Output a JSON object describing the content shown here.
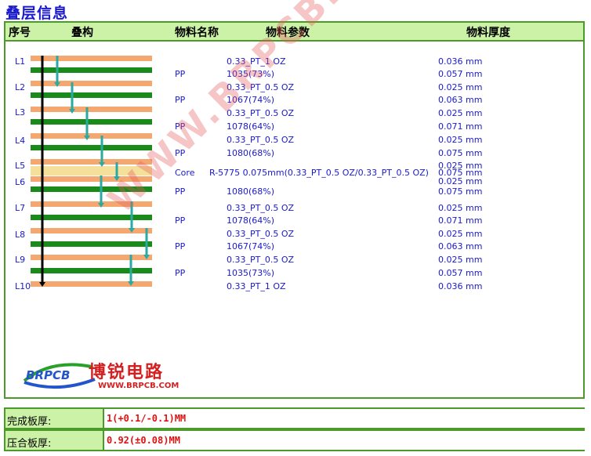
{
  "title": "叠层信息",
  "headers": {
    "seq": "序号",
    "struct": "叠构",
    "material_name": "物料名称",
    "material_param": "物料参数",
    "thickness": "物料厚度"
  },
  "layers": [
    "L1",
    "L2",
    "L3",
    "L4",
    "L5",
    "L6",
    "L7",
    "L8",
    "L9",
    "L10"
  ],
  "rows": [
    {
      "name": "",
      "param": "0.33_PT_1 OZ",
      "thick": "0.036 mm"
    },
    {
      "name": "PP",
      "param": "1035(73%)",
      "thick": "0.057 mm"
    },
    {
      "name": "",
      "param": "0.33_PT_0.5 OZ",
      "thick": "0.025 mm"
    },
    {
      "name": "PP",
      "param": "1067(74%)",
      "thick": "0.063 mm"
    },
    {
      "name": "",
      "param": "0.33_PT_0.5 OZ",
      "thick": "0.025 mm"
    },
    {
      "name": "PP",
      "param": "1078(64%)",
      "thick": "0.071 mm"
    },
    {
      "name": "",
      "param": "0.33_PT_0.5 OZ",
      "thick": "0.025 mm"
    },
    {
      "name": "PP",
      "param": "1080(68%)",
      "thick": "0.075 mm"
    },
    {
      "name": "",
      "param": "",
      "thick": "0.025 mm"
    },
    {
      "name": "Core",
      "param": "R-5775 0.075mm(0.33_PT_0.5 OZ/0.33_PT_0.5 OZ)",
      "thick": "0.075 mm"
    },
    {
      "name": "",
      "param": "",
      "thick": "0.025 mm"
    },
    {
      "name": "PP",
      "param": "1080(68%)",
      "thick": "0.075 mm"
    },
    {
      "name": "",
      "param": "0.33_PT_0.5 OZ",
      "thick": "0.025 mm"
    },
    {
      "name": "PP",
      "param": "1078(64%)",
      "thick": "0.071 mm"
    },
    {
      "name": "",
      "param": "0.33_PT_0.5 OZ",
      "thick": "0.025 mm"
    },
    {
      "name": "PP",
      "param": "1067(74%)",
      "thick": "0.063 mm"
    },
    {
      "name": "",
      "param": "0.33_PT_0.5 OZ",
      "thick": "0.025 mm"
    },
    {
      "name": "PP",
      "param": "1035(73%)",
      "thick": "0.057 mm"
    },
    {
      "name": "",
      "param": "0.33_PT_1 OZ",
      "thick": "0.036 mm"
    }
  ],
  "watermark": "WWW.BRPCB.COM",
  "logo": {
    "badge": "BRPCB",
    "brand": "博锐电路",
    "url": "WWW.BRPCB.COM"
  },
  "summary": [
    {
      "label": "完成板厚:",
      "value": "1(+0.1/-0.1)MM"
    },
    {
      "label": "压合板厚:",
      "value": "0.92(±0.08)MM"
    }
  ],
  "colors": {
    "copper": "#f4a870",
    "dielectric": "#1a8a1a",
    "core": "#f4e09a",
    "arrow": "#2aaaa0",
    "border": "#4c9a2a",
    "header_bg": "#ccf2a8"
  }
}
